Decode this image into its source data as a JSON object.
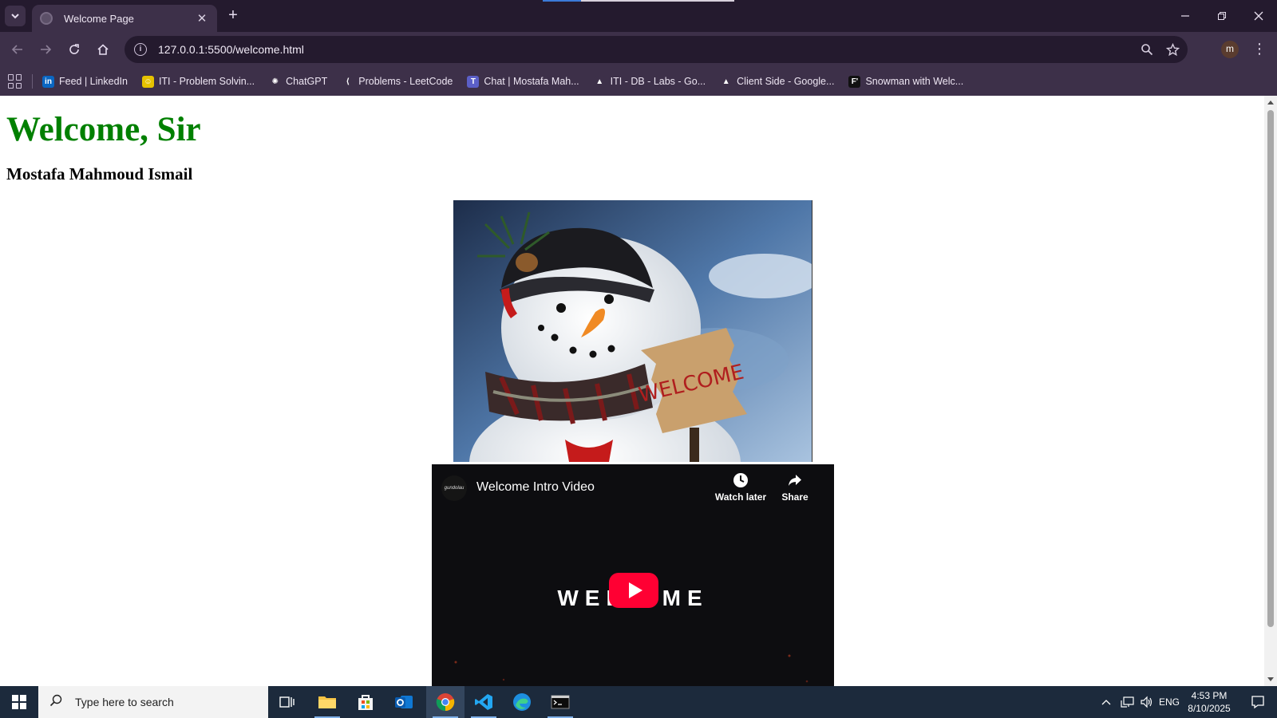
{
  "browser": {
    "tab_title": "Welcome Page",
    "tab_close": "✕",
    "new_tab": "+",
    "url": "127.0.0.1:5500/welcome.html",
    "profile_initial": "m",
    "bookmarks": [
      {
        "label": "Feed | LinkedIn",
        "icon": "in",
        "color": "#0a66c2"
      },
      {
        "label": "ITI - Problem Solvin...",
        "icon": "☺",
        "color": "#e6c200"
      },
      {
        "label": "ChatGPT",
        "icon": "✺",
        "color": "#3d3049"
      },
      {
        "label": "Problems - LeetCode",
        "icon": "⟨",
        "color": "#3d3049"
      },
      {
        "label": "Chat | Mostafa Mah...",
        "icon": "T",
        "color": "#5b5fc7"
      },
      {
        "label": "ITI - DB - Labs - Go...",
        "icon": "▲",
        "color": "#3d3049"
      },
      {
        "label": "Client Side - Google...",
        "icon": "▲",
        "color": "#3d3049"
      },
      {
        "label": "Snowman with Welc...",
        "icon": "F'",
        "color": "#111111"
      }
    ]
  },
  "page": {
    "heading": "Welcome, Sir",
    "subheading": "Mostafa Mahmoud Ismail",
    "image_sign_text": "WELCOME",
    "video": {
      "channel": "gundolau",
      "title": "Welcome Intro Video",
      "watch_later": "Watch later",
      "share": "Share",
      "frame_text": "WEL   OME"
    }
  },
  "taskbar": {
    "search_placeholder": "Type here to search",
    "language": "ENG",
    "time": "4:53 PM",
    "date": "8/10/2025"
  },
  "colors": {
    "heading": "#008000",
    "chrome_dark": "#241a2e",
    "chrome_mid": "#3d3049",
    "youtube_red": "#ff0033",
    "taskbar": "#1c2a3c"
  }
}
